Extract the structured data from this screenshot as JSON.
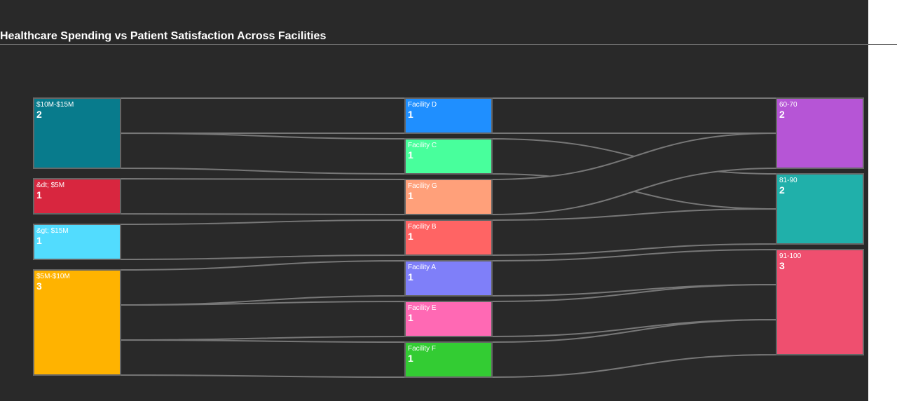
{
  "title": "Healthcare Spending vs Patient Satisfaction Across Facilities",
  "colors": {
    "background": "#292929",
    "link": "#777777",
    "node_border": "#666666",
    "text": "#ffffff"
  },
  "chart_data": {
    "type": "sankey",
    "columns": [
      [
        {
          "id": "s1015",
          "label": "$10M-$15M",
          "value": 2,
          "color": "#087b8c"
        },
        {
          "id": "slt5",
          "label": "&dt; $5M",
          "value": 1,
          "color": "#d8263f"
        },
        {
          "id": "sgt15",
          "label": "&gt; $15M",
          "value": 1,
          "color": "#52dcfe"
        },
        {
          "id": "s510",
          "label": "$5M-$10M",
          "value": 3,
          "color": "#ffb300"
        }
      ],
      [
        {
          "id": "fD",
          "label": "Facility D",
          "value": 1,
          "color": "#1f8fff"
        },
        {
          "id": "fC",
          "label": "Facility C",
          "value": 1,
          "color": "#48ff9c"
        },
        {
          "id": "fG",
          "label": "Facility G",
          "value": 1,
          "color": "#ffa07a"
        },
        {
          "id": "fB",
          "label": "Facility B",
          "value": 1,
          "color": "#ff6464"
        },
        {
          "id": "fA",
          "label": "Facility A",
          "value": 1,
          "color": "#7f7ff9"
        },
        {
          "id": "fE",
          "label": "Facility E",
          "value": 1,
          "color": "#ff69b4"
        },
        {
          "id": "fF",
          "label": "Facility F",
          "value": 1,
          "color": "#33cc33"
        }
      ],
      [
        {
          "id": "r6070",
          "label": "60-70",
          "value": 2,
          "color": "#b655d6"
        },
        {
          "id": "r8190",
          "label": "81-90",
          "value": 2,
          "color": "#20b0aa"
        },
        {
          "id": "r91100",
          "label": "91-100",
          "value": 3,
          "color": "#ef4f6f"
        }
      ]
    ],
    "links": [
      {
        "source": "s1015",
        "target": "fD",
        "value": 1
      },
      {
        "source": "s1015",
        "target": "fC",
        "value": 1
      },
      {
        "source": "slt5",
        "target": "fG",
        "value": 1
      },
      {
        "source": "sgt15",
        "target": "fB",
        "value": 1
      },
      {
        "source": "s510",
        "target": "fA",
        "value": 1
      },
      {
        "source": "s510",
        "target": "fE",
        "value": 1
      },
      {
        "source": "s510",
        "target": "fF",
        "value": 1
      },
      {
        "source": "fD",
        "target": "r6070",
        "value": 1
      },
      {
        "source": "fC",
        "target": "r8190",
        "value": 1
      },
      {
        "source": "fG",
        "target": "r6070",
        "value": 1
      },
      {
        "source": "fB",
        "target": "r8190",
        "value": 1
      },
      {
        "source": "fA",
        "target": "r91100",
        "value": 1
      },
      {
        "source": "fE",
        "target": "r91100",
        "value": 1
      },
      {
        "source": "fF",
        "target": "r91100",
        "value": 1
      }
    ]
  }
}
